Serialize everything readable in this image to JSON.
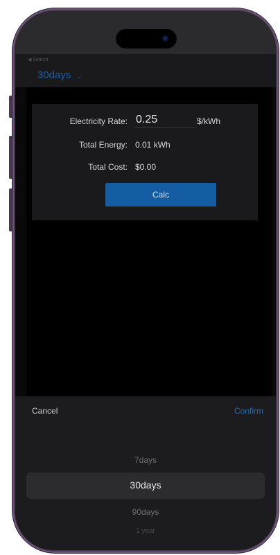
{
  "status": {
    "back_label": "◀ Search"
  },
  "nav": {
    "title": "30days",
    "chevron": "⌄"
  },
  "calculator": {
    "rate_label": "Electricity Rate:",
    "rate_value": "0.25",
    "rate_unit": "$/kWh",
    "energy_label": "Total Energy:",
    "energy_value": "0.01 kWh",
    "cost_label": "Total Cost:",
    "cost_value": "$0.00",
    "calc_button": "Calc"
  },
  "picker": {
    "cancel_label": "Cancel",
    "confirm_label": "Confirm",
    "options": [
      "7days",
      "30days",
      "90days",
      "1 year"
    ],
    "selected": "30days"
  },
  "colors": {
    "accent": "#155da3",
    "link": "#1f6cb8",
    "frame": "#4a3752"
  },
  "icons": {
    "camera": "camera-dot-icon",
    "chevron": "chevron-down-icon"
  }
}
